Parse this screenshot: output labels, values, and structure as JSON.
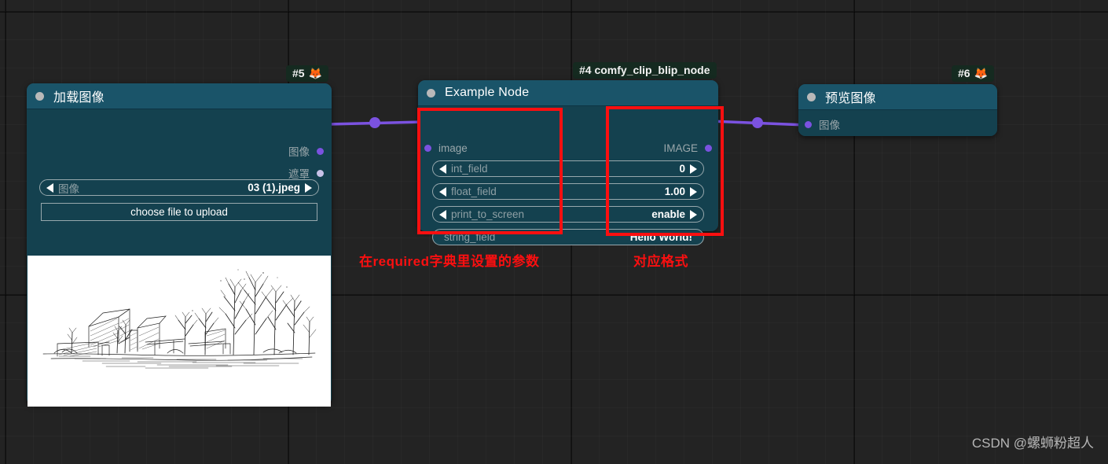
{
  "canvas": {
    "background_color": "#232323",
    "grid_color": "#2b2b2b",
    "link_color": "#7b52e0"
  },
  "nodes": [
    {
      "id": "load-image",
      "badge": "#5",
      "badge_icon": "fox-icon",
      "title": "加载图像",
      "outputs": [
        {
          "label": "图像",
          "type": "IMAGE",
          "color": "#7b52e0"
        },
        {
          "label": "遮罩",
          "type": "MASK",
          "color": "#c8c2e8"
        }
      ],
      "widgets": [
        {
          "name": "图像",
          "value": "03 (1).jpeg",
          "left_arrow": true,
          "right_arrow": true
        },
        {
          "name": "choose file to upload",
          "kind": "button"
        }
      ],
      "preview_alt": "architectural pen sketch of a house with bare trees"
    },
    {
      "id": "example-node",
      "badge": "#4 comfy_clip_blip_node",
      "title": "Example Node",
      "inputs": [
        {
          "label": "image",
          "type": "IMAGE",
          "color": "#7b52e0"
        }
      ],
      "outputs": [
        {
          "label": "IMAGE",
          "type": "IMAGE",
          "color": "#7b52e0"
        }
      ],
      "widgets": [
        {
          "name": "int_field",
          "value": "0",
          "left_arrow": true,
          "right_arrow": true
        },
        {
          "name": "float_field",
          "value": "1.00",
          "left_arrow": true,
          "right_arrow": true
        },
        {
          "name": "print_to_screen",
          "value": "enable",
          "left_arrow": true,
          "right_arrow": true
        },
        {
          "name": "string_field",
          "value": "Hello World!",
          "left_arrow": false,
          "right_arrow": false
        }
      ]
    },
    {
      "id": "preview-image",
      "badge": "#6",
      "badge_icon": "fox-icon",
      "title": "预览图像",
      "inputs": [
        {
          "label": "图像",
          "type": "IMAGE",
          "color": "#7b52e0"
        }
      ]
    }
  ],
  "annotations": {
    "box_color": "#fb0f10",
    "left_label": "在required字典里设置的参数",
    "right_label": "对应格式"
  },
  "watermark": "CSDN @螺蛳粉超人"
}
